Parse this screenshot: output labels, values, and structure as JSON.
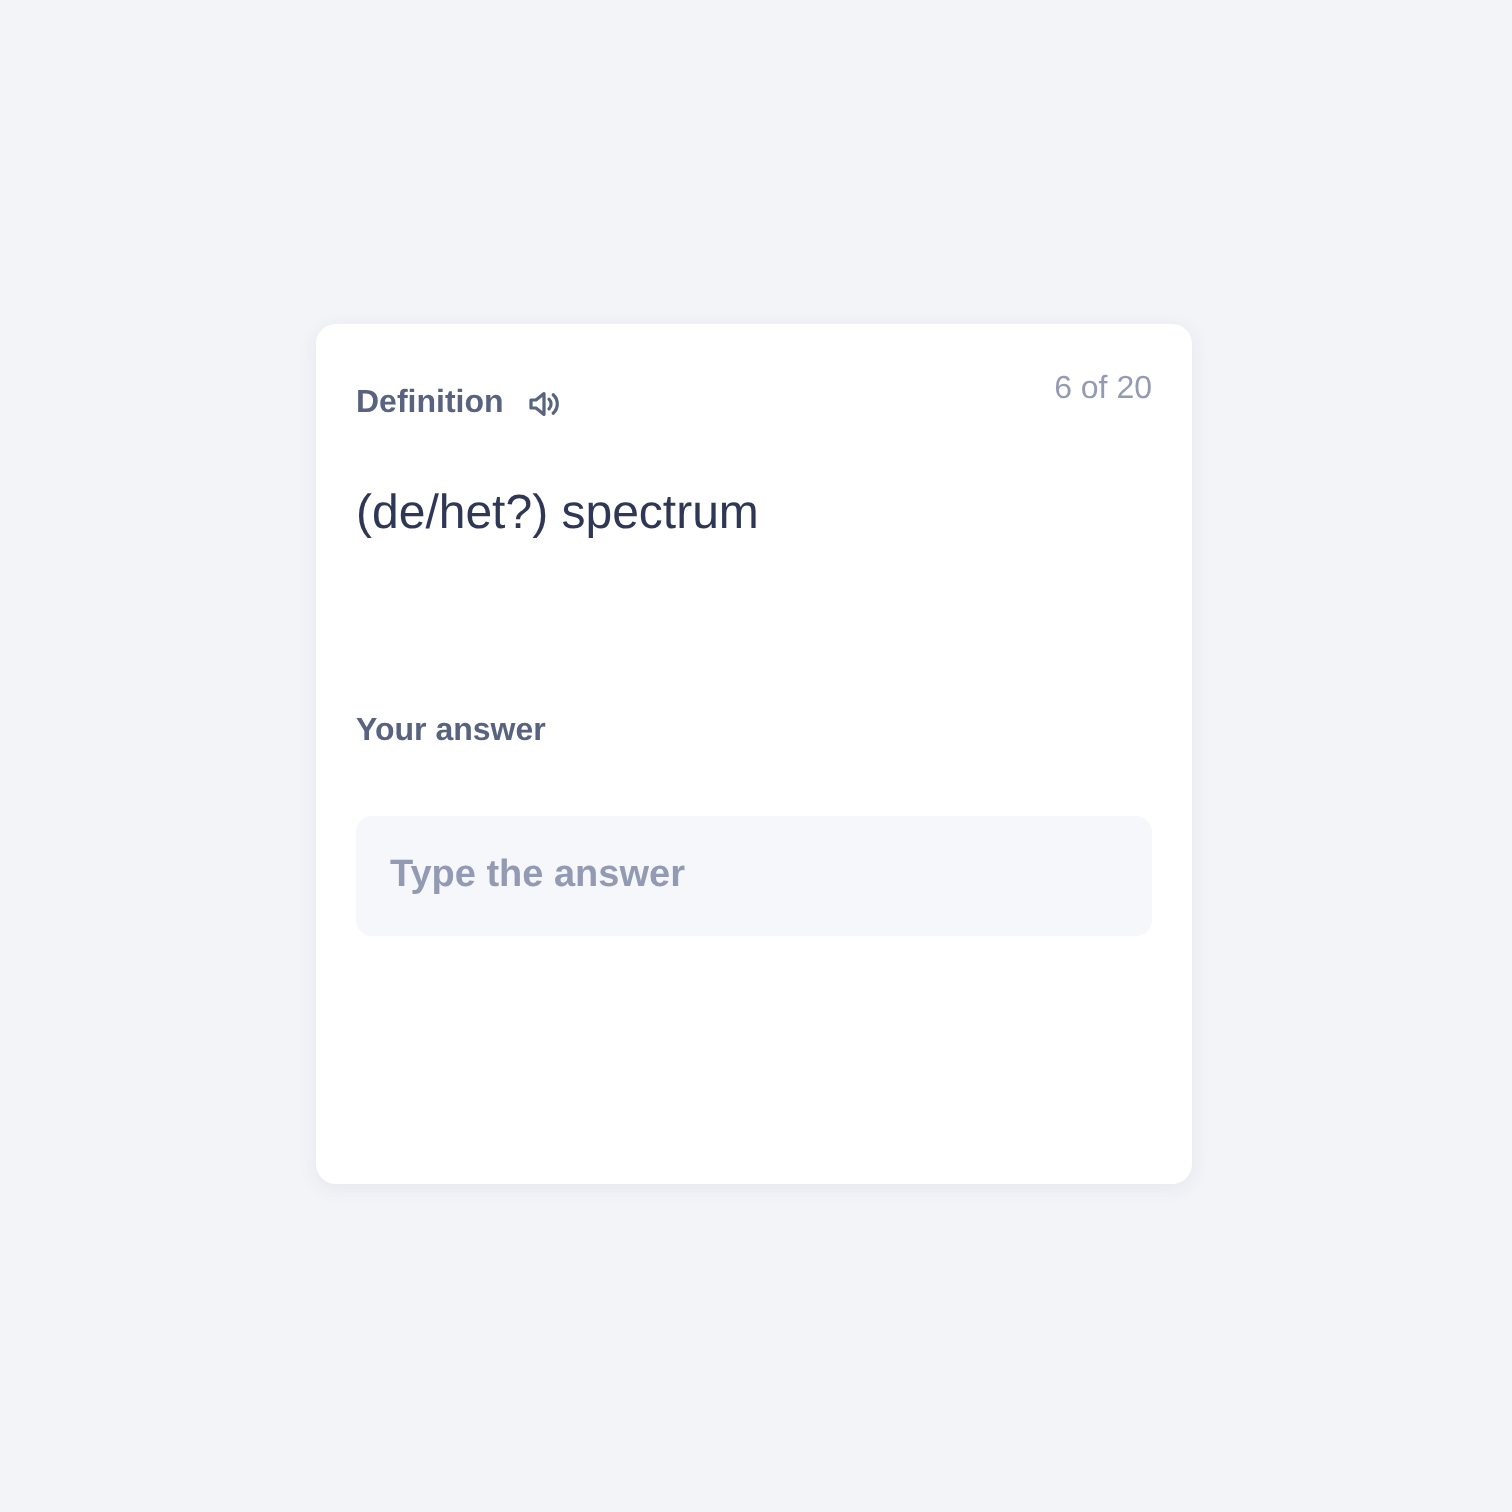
{
  "card": {
    "prompt_label": "Definition",
    "counter": "6 of 20",
    "term": "(de/het?) spectrum",
    "answer_label": "Your answer",
    "answer_field": {
      "placeholder": "Type the answer"
    }
  }
}
